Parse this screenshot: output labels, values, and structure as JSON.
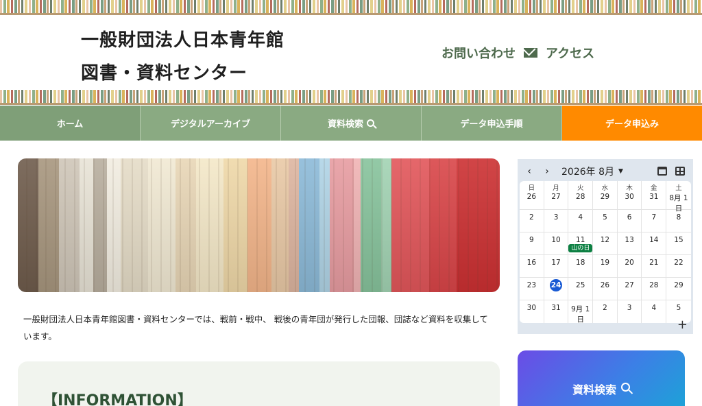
{
  "header": {
    "title_line1": "一般財団法人日本青年館",
    "title_line2": "図書・資料センター",
    "contact_label": "お問い合わせ",
    "access_label": "アクセス"
  },
  "nav": {
    "items": [
      {
        "label": "ホーム"
      },
      {
        "label": "デジタルアーカイブ"
      },
      {
        "label": "資料検索"
      },
      {
        "label": "データ申込手順"
      },
      {
        "label": "データ申込み"
      }
    ],
    "accent_color": "#ff8a00",
    "base_color": "#8aaa82"
  },
  "intro": {
    "text": "一般財団法人日本青年館図書・資料センターでは、戦前・戦中、 戦後の青年団が発行した団報、団誌など資料を収集しています。"
  },
  "information": {
    "title": "【INFORMATION】"
  },
  "calendar": {
    "month_label": "2026年 8月",
    "weekdays": [
      "日",
      "月",
      "火",
      "水",
      "木",
      "金",
      "土"
    ],
    "first_row": [
      "26",
      "27",
      "28",
      "29",
      "30",
      "31",
      "8月 1日"
    ],
    "weeks": [
      [
        "2",
        "3",
        "4",
        "5",
        "6",
        "7",
        "8"
      ],
      [
        "9",
        "10",
        "11",
        "12",
        "13",
        "14",
        "15"
      ],
      [
        "16",
        "17",
        "18",
        "19",
        "20",
        "21",
        "22"
      ],
      [
        "23",
        "24",
        "25",
        "26",
        "27",
        "28",
        "29"
      ],
      [
        "30",
        "31",
        "9月 1日",
        "2",
        "3",
        "4",
        "5"
      ]
    ],
    "holiday_label": "山の日",
    "today": "24",
    "today_color": "#1a5bd4",
    "holiday_color": "#0d8043"
  },
  "search_card": {
    "label": "資料検索"
  }
}
